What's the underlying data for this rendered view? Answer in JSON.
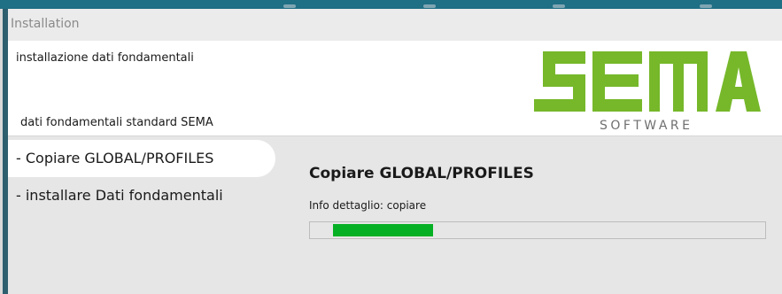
{
  "window": {
    "title": "Installation"
  },
  "header": {
    "title": "installazione dati fondamentali",
    "subtitle": "dati fondamentali standard SEMA",
    "logo": {
      "wordmark": "SEMA",
      "tagline": "SOFTWARE",
      "color": "#76b82a"
    }
  },
  "steps": [
    {
      "label": "- Copiare GLOBAL/PROFILES",
      "active": true
    },
    {
      "label": "- installare Dati fondamentali",
      "active": false
    }
  ],
  "content": {
    "heading": "Copiare GLOBAL/PROFILES",
    "detail": "Info dettaglio: copiare",
    "progress": {
      "start_fraction": 0.05,
      "end_fraction": 0.27,
      "color": "#06b025"
    }
  }
}
